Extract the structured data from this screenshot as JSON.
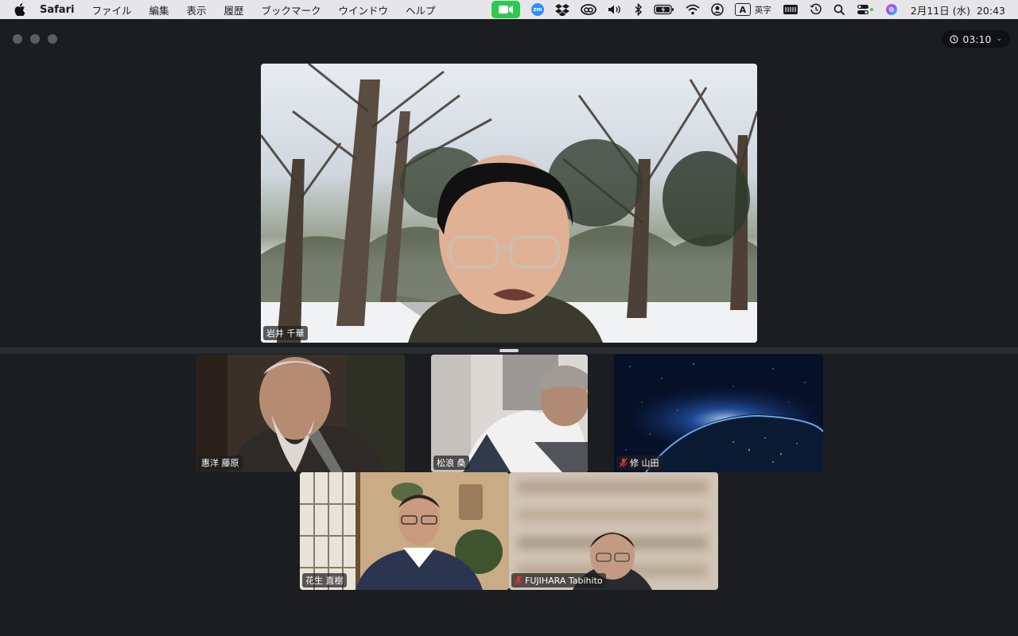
{
  "menubar": {
    "app_name": "Safari",
    "menus": [
      "ファイル",
      "編集",
      "表示",
      "履歴",
      "ブックマーク",
      "ウインドウ",
      "ヘルプ"
    ],
    "status_icons": [
      "zoom-video-icon",
      "zoom-app-icon",
      "dropbox-icon",
      "creative-cloud-icon",
      "volume-icon",
      "bluetooth-icon",
      "battery-icon",
      "wifi-icon",
      "user-icon",
      "input-source-icon",
      "keyboard-icon",
      "time-machine-icon",
      "search-icon",
      "control-center-icon",
      "siri-icon"
    ],
    "zm_label": "zm",
    "input_source_letter": "A",
    "input_source_label": "英字",
    "date": "2月11日 (水)",
    "time": "20:43"
  },
  "meeting": {
    "timer": "03:10",
    "speaker": {
      "name": "岩井 千華",
      "muted": false
    },
    "participants": [
      {
        "name": "惠洋 藤原",
        "muted": false
      },
      {
        "name": "松浪 桑",
        "muted": false
      },
      {
        "name": "修 山田",
        "muted": true
      },
      {
        "name": "花生 直樹",
        "muted": false
      },
      {
        "name": "FUJIHARA Tabihito",
        "muted": true
      }
    ]
  },
  "colors": {
    "menubar_bg": "#e6e6e8",
    "window_bg": "#1b1d20",
    "zoom_green": "#2dc94e",
    "zoom_blue": "#2d8cff",
    "mute_red": "#e0323a"
  }
}
